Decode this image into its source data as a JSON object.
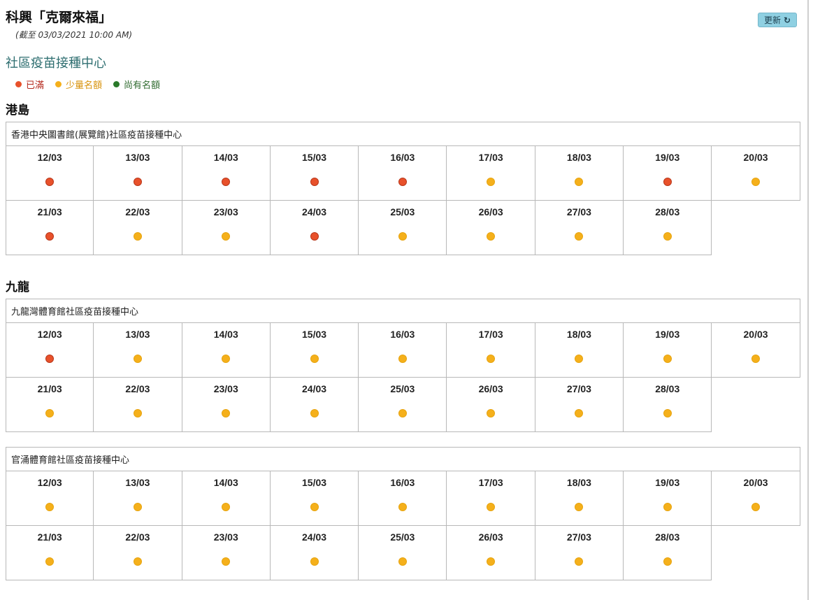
{
  "header": {
    "title": "科興「克爾來福」",
    "update_time": "(截至 03/03/2021 10:00 AM)",
    "refresh_label": "更新",
    "refresh_icon": "↻"
  },
  "section_title": "社區疫苗接種中心",
  "legend": [
    {
      "label": "已滿",
      "status": "full",
      "color": "#e8512b",
      "text_color": "#b52a1e"
    },
    {
      "label": "少量名額",
      "status": "few",
      "color": "#f5b01b",
      "text_color": "#d8930d"
    },
    {
      "label": "尚有名額",
      "status": "available",
      "color": "#2a7a2a",
      "text_color": "#2f6b2f"
    }
  ],
  "regions": [
    {
      "name": "港島",
      "centers": [
        {
          "name": "香港中央圖書館(展覽館)社區疫苗接種中心",
          "dates": [
            {
              "date": "12/03",
              "status": "full"
            },
            {
              "date": "13/03",
              "status": "full"
            },
            {
              "date": "14/03",
              "status": "full"
            },
            {
              "date": "15/03",
              "status": "full"
            },
            {
              "date": "16/03",
              "status": "full"
            },
            {
              "date": "17/03",
              "status": "few"
            },
            {
              "date": "18/03",
              "status": "few"
            },
            {
              "date": "19/03",
              "status": "full"
            },
            {
              "date": "20/03",
              "status": "few"
            },
            {
              "date": "21/03",
              "status": "full"
            },
            {
              "date": "22/03",
              "status": "few"
            },
            {
              "date": "23/03",
              "status": "few"
            },
            {
              "date": "24/03",
              "status": "full"
            },
            {
              "date": "25/03",
              "status": "few"
            },
            {
              "date": "26/03",
              "status": "few"
            },
            {
              "date": "27/03",
              "status": "few"
            },
            {
              "date": "28/03",
              "status": "few"
            }
          ]
        }
      ]
    },
    {
      "name": "九龍",
      "centers": [
        {
          "name": "九龍灣體育館社區疫苗接種中心",
          "dates": [
            {
              "date": "12/03",
              "status": "full"
            },
            {
              "date": "13/03",
              "status": "few"
            },
            {
              "date": "14/03",
              "status": "few"
            },
            {
              "date": "15/03",
              "status": "few"
            },
            {
              "date": "16/03",
              "status": "few"
            },
            {
              "date": "17/03",
              "status": "few"
            },
            {
              "date": "18/03",
              "status": "few"
            },
            {
              "date": "19/03",
              "status": "few"
            },
            {
              "date": "20/03",
              "status": "few"
            },
            {
              "date": "21/03",
              "status": "few"
            },
            {
              "date": "22/03",
              "status": "few"
            },
            {
              "date": "23/03",
              "status": "few"
            },
            {
              "date": "24/03",
              "status": "few"
            },
            {
              "date": "25/03",
              "status": "few"
            },
            {
              "date": "26/03",
              "status": "few"
            },
            {
              "date": "27/03",
              "status": "few"
            },
            {
              "date": "28/03",
              "status": "few"
            }
          ]
        },
        {
          "name": "官涌體育館社區疫苗接種中心",
          "dates": [
            {
              "date": "12/03",
              "status": "few"
            },
            {
              "date": "13/03",
              "status": "few"
            },
            {
              "date": "14/03",
              "status": "few"
            },
            {
              "date": "15/03",
              "status": "few"
            },
            {
              "date": "16/03",
              "status": "few"
            },
            {
              "date": "17/03",
              "status": "few"
            },
            {
              "date": "18/03",
              "status": "few"
            },
            {
              "date": "19/03",
              "status": "few"
            },
            {
              "date": "20/03",
              "status": "few"
            },
            {
              "date": "21/03",
              "status": "few"
            },
            {
              "date": "22/03",
              "status": "few"
            },
            {
              "date": "23/03",
              "status": "few"
            },
            {
              "date": "24/03",
              "status": "few"
            },
            {
              "date": "25/03",
              "status": "few"
            },
            {
              "date": "26/03",
              "status": "few"
            },
            {
              "date": "27/03",
              "status": "few"
            },
            {
              "date": "28/03",
              "status": "few"
            }
          ]
        }
      ]
    }
  ]
}
